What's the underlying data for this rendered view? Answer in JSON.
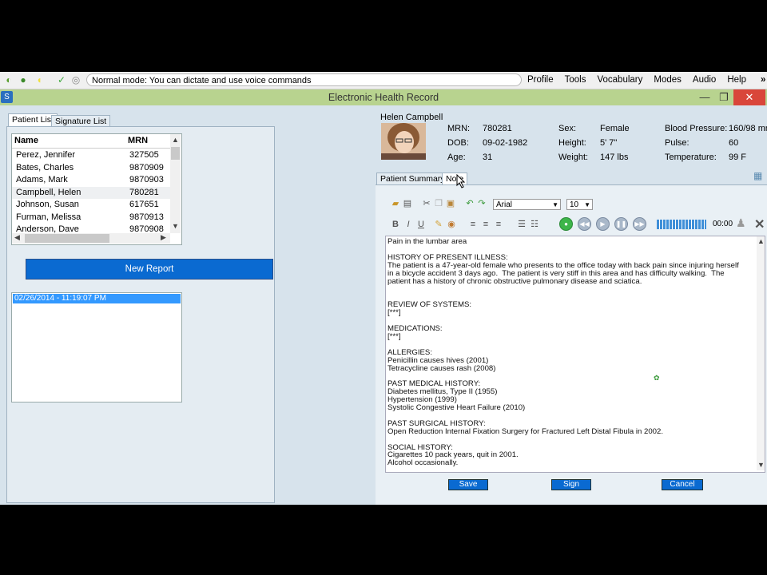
{
  "dragon": {
    "status_text": "Normal mode: You can dictate and use voice commands",
    "menus": [
      "Profile",
      "Tools",
      "Vocabulary",
      "Modes",
      "Audio",
      "Help"
    ],
    "menu_more": "»"
  },
  "window": {
    "title": "Electronic Health Record",
    "minimize": "—",
    "maximize": "❐",
    "close": "✕",
    "app_icon": "S"
  },
  "left": {
    "tabs": [
      "Patient List",
      "Signature List"
    ],
    "columns": [
      "Name",
      "MRN"
    ],
    "patients": [
      {
        "name": "Perez, Jennifer",
        "mrn": "327505"
      },
      {
        "name": "Bates, Charles",
        "mrn": "9870909"
      },
      {
        "name": "Adams, Mark",
        "mrn": "9870903"
      },
      {
        "name": "Campbell, Helen",
        "mrn": "780281"
      },
      {
        "name": "Johnson, Susan",
        "mrn": "617651"
      },
      {
        "name": "Furman, Melissa",
        "mrn": "9870913"
      },
      {
        "name": "Anderson, Dave",
        "mrn": "9870908"
      }
    ],
    "new_report": "New Report",
    "report_item": "02/26/2014 - 11:19:07 PM"
  },
  "patient": {
    "name": "Helen Campbell",
    "mrn_label": "MRN:",
    "mrn": "780281",
    "dob_label": "DOB:",
    "dob": "09-02-1982",
    "age_label": "Age:",
    "age": "31",
    "sex_label": "Sex:",
    "sex": "Female",
    "height_label": "Height:",
    "height": "5' 7\"",
    "weight_label": "Weight:",
    "weight": "147 lbs",
    "bp_label": "Blood Pressure:",
    "bp": "160/98 mm",
    "pulse_label": "Pulse:",
    "pulse": "60",
    "temp_label": "Temperature:",
    "temp": "99 F"
  },
  "note": {
    "tabs": [
      "Patient Summary",
      "Note"
    ],
    "font": "Arial",
    "size": "10",
    "time": "00:00",
    "bold": "B",
    "italic": "I",
    "underline": "U",
    "text": "Pain in the lumbar area\n\nHISTORY OF PRESENT ILLNESS:\nThe patient is a 47-year-old female who presents to the office today with back pain since injuring herself\nin a bicycle accident 3 days ago.  The patient is very stiff in this area and has difficulty walking.  The\npatient has a history of chronic obstructive pulmonary disease and sciatica.\n\n\nREVIEW OF SYSTEMS:\n[***]\n\nMEDICATIONS:\n[***]\n\nALLERGIES:\nPenicillin causes hives (2001)\nTetracycline causes rash (2008)\n\nPAST MEDICAL HISTORY:\nDiabetes mellitus, Type II (1955)\nHypertension (1999)\nSystolic Congestive Heart Failure (2010)\n\nPAST SURGICAL HISTORY:\nOpen Reduction Internal Fixation Surgery for Fractured Left Distal Fibula in 2002.\n\nSOCIAL HISTORY:\nCigarettes 10 pack years, quit in 2001.\nAlcohol occasionally.\n\nFAMILY HISTORY:",
    "save": "Save",
    "sign": "Sign",
    "cancel": "Cancel"
  }
}
